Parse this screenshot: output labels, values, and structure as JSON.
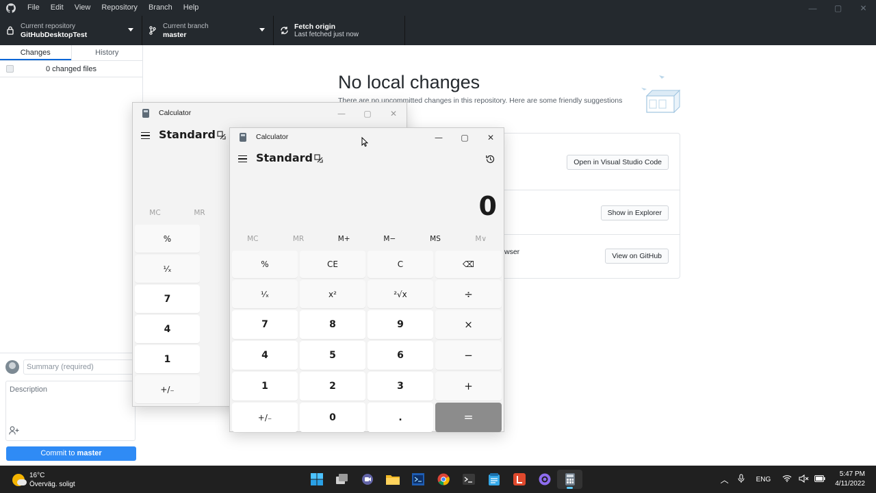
{
  "menubar": {
    "items": [
      "File",
      "Edit",
      "View",
      "Repository",
      "Branch",
      "Help"
    ]
  },
  "toolbar": {
    "repo_label": "Current repository",
    "repo_value": "GitHubDesktopTest",
    "branch_label": "Current branch",
    "branch_value": "master",
    "fetch_label": "Fetch origin",
    "fetch_sub": "Last fetched just now"
  },
  "sidebar": {
    "tab_changes": "Changes",
    "tab_history": "History",
    "changed_files": "0 changed files",
    "summary_placeholder": "Summary (required)",
    "description_placeholder": "Description",
    "commit_prefix": "Commit to ",
    "commit_branch": "master"
  },
  "main": {
    "title": "No local changes",
    "subtitle": "There are no uncommitted changes in this repository. Here are some friendly suggestions for",
    "btn_vscode": "Open in Visual Studio Code",
    "btn_explorer": "Show in Explorer",
    "btn_github": "View on GitHub",
    "fragment_browser": "wser"
  },
  "calc_back": {
    "title": "Calculator",
    "mode": "Standard",
    "mem": [
      "MC",
      "MR"
    ],
    "keys": [
      "%",
      "¹⁄ₓ",
      "7",
      "4",
      "1",
      "+/₋"
    ]
  },
  "calc_front": {
    "title": "Calculator",
    "mode": "Standard",
    "display": "0",
    "mem": [
      "MC",
      "MR",
      "M+",
      "M−",
      "MS",
      "M∨"
    ],
    "keys": [
      "%",
      "CE",
      "C",
      "⌫",
      "¹⁄ₓ",
      "x²",
      "²√x",
      "÷",
      "7",
      "8",
      "9",
      "×",
      "4",
      "5",
      "6",
      "−",
      "1",
      "2",
      "3",
      "+",
      "+/₋",
      "0",
      ".",
      "="
    ]
  },
  "taskbar": {
    "temperature": "16°C",
    "weather": "Överväg. soligt",
    "language": "ENG",
    "time": "5:47 PM",
    "date": "4/11/2022"
  },
  "colors": {
    "dark_chrome": "#24292e",
    "accent_blue": "#2f8bf5",
    "tab_underline": "#0366d6",
    "calc_bg": "#f3f3f3",
    "equals_key": "#8c8c8c",
    "taskbar": "#202020"
  }
}
